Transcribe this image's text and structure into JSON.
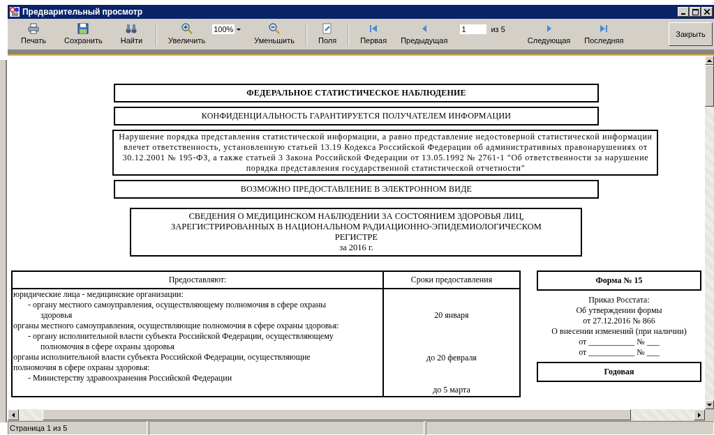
{
  "window": {
    "title": "Предварительный просмотр"
  },
  "toolbar": {
    "groups": [
      [
        {
          "kind": "button",
          "label": "Печать"
        },
        {
          "kind": "button",
          "label": "Сохранить"
        },
        {
          "kind": "button",
          "label": "Найти"
        }
      ],
      [
        {
          "kind": "button",
          "label": "Увеличить"
        },
        {
          "kind": "zoom",
          "value": "100%"
        },
        {
          "kind": "button",
          "label": "Уменьшить"
        }
      ],
      [
        {
          "kind": "button",
          "label": "Поля"
        }
      ],
      [
        {
          "kind": "button",
          "label": "Первая"
        },
        {
          "kind": "button",
          "label": "Предыдущая"
        },
        {
          "kind": "page",
          "value": "1",
          "total": "из 5"
        },
        {
          "kind": "button",
          "label": "Следующая"
        },
        {
          "kind": "button",
          "label": "Последняя"
        }
      ]
    ],
    "close": "Закрыть"
  },
  "document": {
    "heading": "ФЕДЕРАЛЬНОЕ СТАТИСТИЧЕСКОЕ НАБЛЮДЕНИЕ",
    "confidentiality": "КОНФИДЕНЦИАЛЬНОСТЬ ГАРАНТИРУЕТСЯ ПОЛУЧАТЕЛЕМ ИНФОРМАЦИИ",
    "warning": "Нарушение порядка представления статистической информации, а равно представление недостоверной статистической информации влечет ответственность, установленную статьей 13.19 Кодекса Российской Федерации об административных правонарушениях от 30.12.2001 № 195-ФЗ, а также статьей 3 Закона Российской Федерации от 13.05.1992 № 2761-1 \"Об ответственности за нарушение порядка представления государственной статистической отчетности\"",
    "electronic": "ВОЗМОЖНО ПРЕДОСТАВЛЕНИЕ В ЭЛЕКТРОННОМ ВИДЕ",
    "title": "СВЕДЕНИЯ О МЕДИЦИНСКОМ НАБЛЮДЕНИИ ЗА СОСТОЯНИЕМ ЗДОРОВЬЯ ЛИЦ, ЗАРЕГИСТРИРОВАННЫХ В НАЦИОНАЛЬНОМ РАДИАЦИОННО-ЭПИДЕМИОЛОГИЧЕСКОМ РЕГИСТРЕ",
    "period": "за 2016 г.",
    "table": {
      "columns": [
        "Предоставляют:",
        "Сроки предоставления"
      ],
      "rows": [
        {
          "group": "юридические лица - медицинские организации:",
          "recipient": "- органу местного самоуправления, осуществляющему полномочия в сфере охраны здоровья",
          "deadline": "20 января"
        },
        {
          "group": "органы местного самоуправления, осуществляющие полномочия в сфере охраны здоровья:",
          "recipient": "- органу исполнительной власти субъекта Российской Федерации, осуществляющему полномочия в сфере охраны здоровья",
          "deadline": "до 20 февраля"
        },
        {
          "group": "органы исполнительной власти субъекта Российской Федерации, осуществляющие полномочия в сфере охраны здоровья:",
          "recipient": "- Министерству здравоохранения Российской Федерации",
          "deadline": "до 5 марта"
        }
      ]
    },
    "form": {
      "number": "Форма № 15",
      "lines": [
        "Приказ Росстата:",
        "Об утверждении формы",
        "от 27.12.2016 № 866",
        "О внесении изменений (при наличии)",
        "от ___________ № ___",
        "от ___________ № ___"
      ],
      "periodicity": "Годовая"
    }
  },
  "status_bar": {
    "text": "Страница 1 из 5"
  }
}
